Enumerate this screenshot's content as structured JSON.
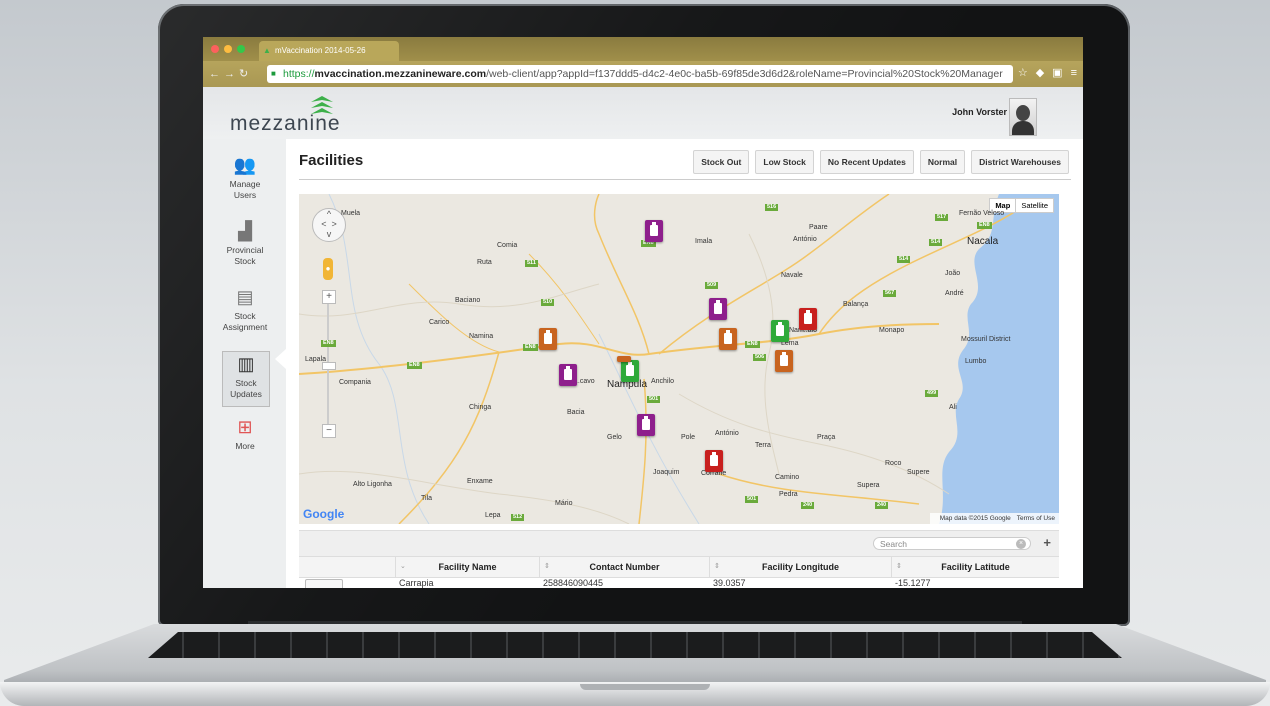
{
  "browser": {
    "tab_title": "mVaccination 2014-05-26",
    "url_https": "https://",
    "url_host": "mvaccination.mezzanineware.com",
    "url_path": "/web-client/app?appId=f137ddd5-d4c2-4e0c-ba5b-69f85de3d6d2&roleName=Provincial%20Stock%20Manager"
  },
  "header": {
    "logo": "mezzanine",
    "user_name": "John Vorster"
  },
  "sidebar": {
    "items": [
      {
        "label": "Manage Users",
        "icon": "users-icon"
      },
      {
        "label": "Provincial Stock",
        "icon": "forklift-icon"
      },
      {
        "label": "Stock Assignment",
        "icon": "form-icon"
      },
      {
        "label": "Stock Updates",
        "icon": "map-icon"
      },
      {
        "label": "More",
        "icon": "sitemap-icon"
      }
    ],
    "active_index": 3
  },
  "page": {
    "title": "Facilities",
    "filters": [
      "Stock Out",
      "Low Stock",
      "No Recent Updates",
      "Normal",
      "District Warehouses"
    ]
  },
  "map": {
    "type_options": [
      "Map",
      "Satellite"
    ],
    "selected_type": "Map",
    "attribution": "Map data ©2015 Google",
    "terms": "Terms of Use",
    "google_logo": "Google",
    "places": [
      "Muela",
      "Comia",
      "Imala",
      "Paare",
      "António",
      "Fernão Veloso",
      "Nacala",
      "Ruta",
      "Navale",
      "João",
      "Baciano",
      "André",
      "Balança",
      "Carico",
      "Namina",
      "Nam..alo",
      "Lema",
      "Monapo",
      "Mossuril District",
      "Lapala",
      "Lumbo",
      "Compania",
      "...cavo",
      "Nampula",
      "Anchilo",
      "Chinga",
      "Bacia",
      "Ali",
      "Gelo",
      "Pole",
      "António",
      "Terra",
      "Praça",
      "Joaquim",
      "Corrane",
      "Roco",
      "Supere",
      "Camino",
      "Supera",
      "Alto Ligonha",
      "Enxame",
      "Pedra",
      "Tila",
      "Mário",
      "Lepa"
    ],
    "roads": [
      "516",
      "517",
      "EN8",
      "514",
      "EN8",
      "511",
      "509",
      "514",
      "510",
      "567",
      "EN8",
      "EN8",
      "506",
      "EN8",
      "EN8",
      "499",
      "501",
      "501",
      "240",
      "240",
      "512"
    ],
    "markers": [
      {
        "status": "purple",
        "color": "#8e1f8c"
      },
      {
        "status": "purple",
        "color": "#8e1f8c"
      },
      {
        "status": "orange",
        "color": "#c8641f"
      },
      {
        "status": "orange",
        "color": "#c8641f"
      },
      {
        "status": "green",
        "color": "#2faa3a"
      },
      {
        "status": "red",
        "color": "#c8201e"
      },
      {
        "status": "orange",
        "color": "#c8641f"
      },
      {
        "status": "purple",
        "color": "#8e1f8c"
      },
      {
        "status": "green",
        "color": "#2faa3a"
      },
      {
        "status": "orange",
        "color": "#c8641f"
      },
      {
        "status": "purple",
        "color": "#8e1f8c"
      },
      {
        "status": "red",
        "color": "#c8201e"
      }
    ]
  },
  "table": {
    "search_placeholder": "Search",
    "add_label": "+",
    "columns": [
      "Facility Name",
      "Contact Number",
      "Facility Longitude",
      "Facility Latitude"
    ],
    "rows": [
      [
        "Carrapia",
        "258846090445",
        "39.0357",
        "-15.1277"
      ]
    ]
  },
  "colors": {
    "accent_green": "#3db04a",
    "tab_bar": "#a08f4a",
    "water": "#a6c8ee",
    "land": "#ebe8e1"
  }
}
